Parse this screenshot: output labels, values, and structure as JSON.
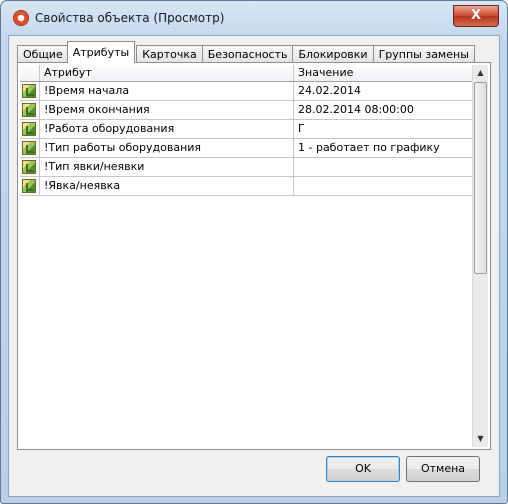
{
  "window": {
    "title": "Свойства объекта (Просмотр)",
    "close_label": "X"
  },
  "tabs": [
    {
      "label": "Общие"
    },
    {
      "label": "Атрибуты"
    },
    {
      "label": "Карточка"
    },
    {
      "label": "Безопасность"
    },
    {
      "label": "Блокировки"
    },
    {
      "label": "Группы замены"
    }
  ],
  "active_tab": "Атрибуты",
  "grid": {
    "columns": {
      "attribute": "Атрибут",
      "value": "Значение"
    },
    "rows": [
      {
        "attribute": "!Время начала",
        "value": "24.02.2014",
        "icon": "attribute-icon"
      },
      {
        "attribute": "!Время окончания",
        "value": "28.02.2014 08:00:00",
        "icon": "attribute-icon"
      },
      {
        "attribute": "!Работа оборудования",
        "value": "Г",
        "icon": "attribute-icon"
      },
      {
        "attribute": "!Тип работы оборудования",
        "value": "1 - работает по графику",
        "icon": "attribute-icon"
      },
      {
        "attribute": "!Тип явки/неявки",
        "value": "",
        "icon": "attribute-icon"
      },
      {
        "attribute": "!Явка/неявка",
        "value": "",
        "icon": "attribute-icon"
      }
    ]
  },
  "buttons": {
    "ok": "OK",
    "cancel": "Отмена"
  },
  "colors": {
    "accent": "#c9452b",
    "selection_border": "#3c7fb1"
  }
}
